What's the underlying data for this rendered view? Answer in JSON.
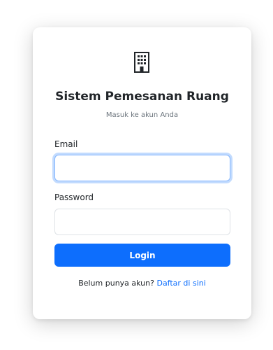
{
  "app": {
    "title": "Sistem Pemesanan Ruang",
    "subtitle": "Masuk ke akun Anda",
    "logo_icon": "building-icon"
  },
  "form": {
    "email_label": "Email",
    "email_value": "",
    "email_placeholder": "",
    "password_label": "Password",
    "password_value": "",
    "password_placeholder": "",
    "login_label": "Login"
  },
  "register": {
    "prompt": "Belum punya akun?",
    "link_label": "Daftar di sini"
  },
  "colors": {
    "primary": "#0d6efd",
    "text": "#212529",
    "muted": "#6c757d",
    "border": "#dee2e6",
    "focus_border": "#86b7fe"
  }
}
